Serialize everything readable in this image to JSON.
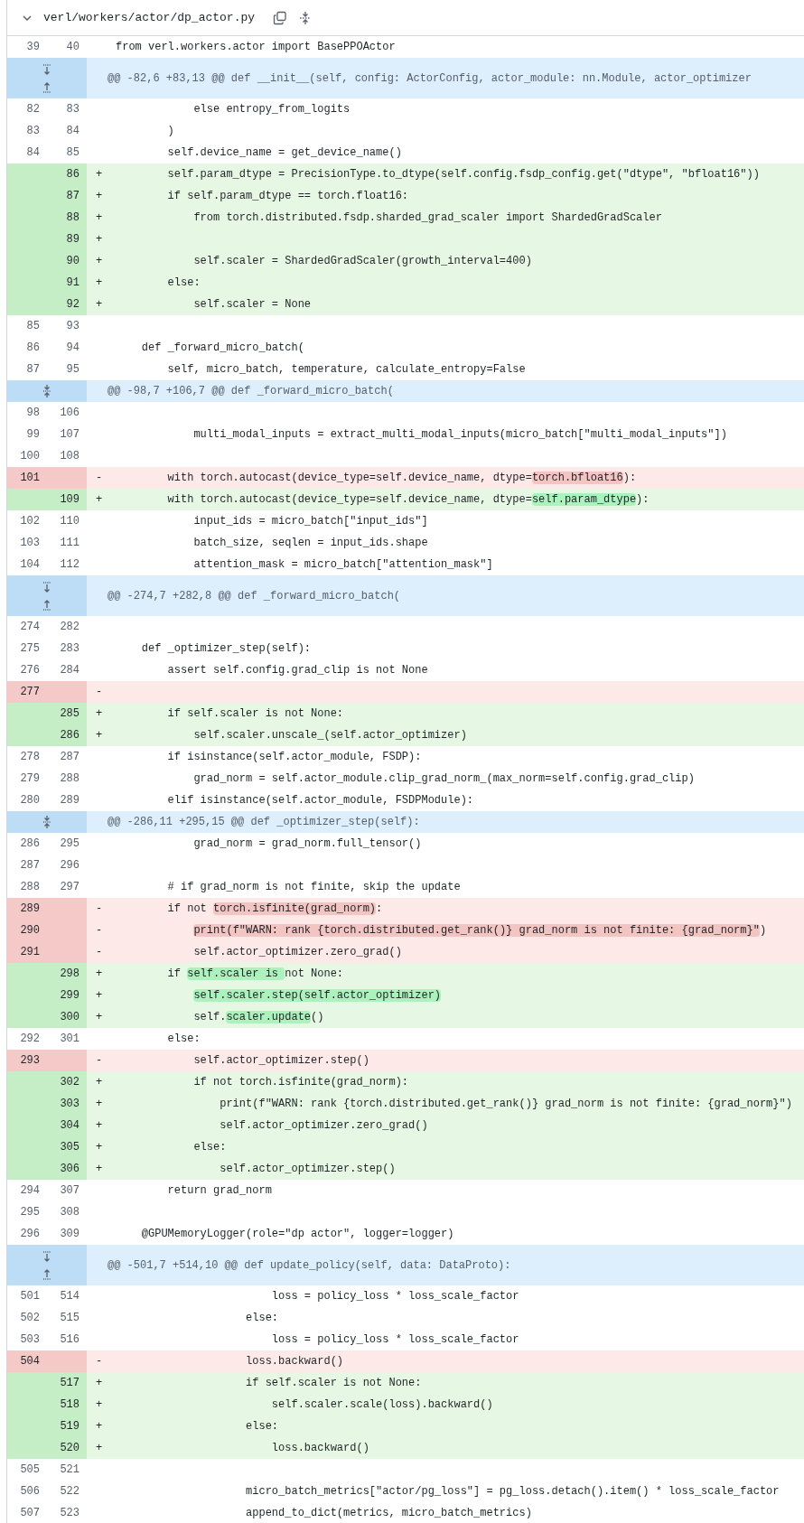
{
  "file_header": {
    "path": "verl/workers/actor/dp_actor.py"
  },
  "rows": [
    {
      "kind": "context",
      "old": "39",
      "new": "40",
      "code": [
        "from verl.workers.actor import BasePPOActor"
      ]
    },
    {
      "kind": "hunk",
      "split_expander": true,
      "code": [
        "@@ -82,6 +83,13 @@ def __init__(self, config: ActorConfig, actor_module: nn.Module, actor_optimizer"
      ]
    },
    {
      "kind": "context",
      "old": "82",
      "new": "83",
      "code": [
        "            else entropy_from_logits"
      ]
    },
    {
      "kind": "context",
      "old": "83",
      "new": "84",
      "code": [
        "        )"
      ]
    },
    {
      "kind": "context",
      "old": "84",
      "new": "85",
      "code": [
        "        self.device_name = get_device_name()"
      ]
    },
    {
      "kind": "add",
      "new": "86",
      "sign": "+",
      "code": [
        "        self.param_dtype = PrecisionType.to_dtype(self.config.fsdp_config.get(\"dtype\", \"bfloat16\"))"
      ]
    },
    {
      "kind": "add",
      "new": "87",
      "sign": "+",
      "code": [
        "        if self.param_dtype == torch.float16:"
      ]
    },
    {
      "kind": "add",
      "new": "88",
      "sign": "+",
      "code": [
        "            from torch.distributed.fsdp.sharded_grad_scaler import ShardedGradScaler"
      ]
    },
    {
      "kind": "add",
      "new": "89",
      "sign": "+"
    },
    {
      "kind": "add",
      "new": "90",
      "sign": "+",
      "code": [
        "            self.scaler = ShardedGradScaler(growth_interval=400)"
      ]
    },
    {
      "kind": "add",
      "new": "91",
      "sign": "+",
      "code": [
        "        else:"
      ]
    },
    {
      "kind": "add",
      "new": "92",
      "sign": "+",
      "code": [
        "            self.scaler = None"
      ]
    },
    {
      "kind": "context",
      "old": "85",
      "new": "93"
    },
    {
      "kind": "context",
      "old": "86",
      "new": "94",
      "code": [
        "    def _forward_micro_batch("
      ]
    },
    {
      "kind": "context",
      "old": "87",
      "new": "95",
      "code": [
        "        self, micro_batch, temperature, calculate_entropy=False"
      ]
    },
    {
      "kind": "hunk",
      "split_expander": false,
      "code": [
        "@@ -98,7 +106,7 @@ def _forward_micro_batch("
      ]
    },
    {
      "kind": "context",
      "old": "98",
      "new": "106"
    },
    {
      "kind": "context",
      "old": "99",
      "new": "107",
      "code": [
        "            multi_modal_inputs = extract_multi_modal_inputs(micro_batch[\"multi_modal_inputs\"])"
      ]
    },
    {
      "kind": "context",
      "old": "100",
      "new": "108"
    },
    {
      "kind": "del",
      "old": "101",
      "sign": "-",
      "code": [
        "        with torch.autocast(device_type=self.device_name, dtype=",
        "torch.bfloat16",
        "):"
      ],
      "changed": [
        false,
        true,
        false
      ]
    },
    {
      "kind": "add",
      "new": "109",
      "sign": "+",
      "code": [
        "        with torch.autocast(device_type=self.device_name, dtype=",
        "self.param_dtype",
        "):"
      ],
      "changed": [
        false,
        true,
        false
      ]
    },
    {
      "kind": "context",
      "old": "102",
      "new": "110",
      "code": [
        "            input_ids = micro_batch[\"input_ids\"]"
      ]
    },
    {
      "kind": "context",
      "old": "103",
      "new": "111",
      "code": [
        "            batch_size, seqlen = input_ids.shape"
      ]
    },
    {
      "kind": "context",
      "old": "104",
      "new": "112",
      "code": [
        "            attention_mask = micro_batch[\"attention_mask\"]"
      ]
    },
    {
      "kind": "hunk",
      "split_expander": true,
      "code": [
        "@@ -274,7 +282,8 @@ def _forward_micro_batch("
      ]
    },
    {
      "kind": "context",
      "old": "274",
      "new": "282"
    },
    {
      "kind": "context",
      "old": "275",
      "new": "283",
      "code": [
        "    def _optimizer_step(self):"
      ]
    },
    {
      "kind": "context",
      "old": "276",
      "new": "284",
      "code": [
        "        assert self.config.grad_clip is not None"
      ]
    },
    {
      "kind": "del",
      "old": "277",
      "sign": "-"
    },
    {
      "kind": "add",
      "new": "285",
      "sign": "+",
      "code": [
        "        if self.scaler is not None:"
      ]
    },
    {
      "kind": "add",
      "new": "286",
      "sign": "+",
      "code": [
        "            self.scaler.unscale_(self.actor_optimizer)"
      ]
    },
    {
      "kind": "context",
      "old": "278",
      "new": "287",
      "code": [
        "        if isinstance(self.actor_module, FSDP):"
      ]
    },
    {
      "kind": "context",
      "old": "279",
      "new": "288",
      "code": [
        "            grad_norm = self.actor_module.clip_grad_norm_(max_norm=self.config.grad_clip)"
      ]
    },
    {
      "kind": "context",
      "old": "280",
      "new": "289",
      "code": [
        "        elif isinstance(self.actor_module, FSDPModule):"
      ]
    },
    {
      "kind": "hunk",
      "split_expander": false,
      "code": [
        "@@ -286,11 +295,15 @@ def _optimizer_step(self):"
      ]
    },
    {
      "kind": "context",
      "old": "286",
      "new": "295",
      "code": [
        "            grad_norm = grad_norm.full_tensor()"
      ]
    },
    {
      "kind": "context",
      "old": "287",
      "new": "296"
    },
    {
      "kind": "context",
      "old": "288",
      "new": "297",
      "code": [
        "        # if grad_norm is not finite, skip the update"
      ]
    },
    {
      "kind": "del",
      "old": "289",
      "sign": "-",
      "code": [
        "        if not ",
        "torch.isfinite(grad_norm)",
        ":"
      ],
      "changed": [
        false,
        true,
        false
      ]
    },
    {
      "kind": "del",
      "old": "290",
      "sign": "-",
      "code": [
        "            print(f\"WARN: rank {torch.distributed.get_rank()} grad_norm is not finite: {grad_norm}\"",
        ")"
      ],
      "changed": [
        true,
        false
      ]
    },
    {
      "kind": "del",
      "old": "291",
      "sign": "-",
      "code": [
        "            self.actor_optimizer.zero_grad()"
      ]
    },
    {
      "kind": "add",
      "new": "298",
      "sign": "+",
      "code": [
        "        if ",
        "self.scaler is ",
        "not None:"
      ],
      "changed": [
        false,
        true,
        false
      ]
    },
    {
      "kind": "add",
      "new": "299",
      "sign": "+",
      "code": [
        "            self.scaler.step(self.actor_optimizer)"
      ],
      "changed": [
        true
      ]
    },
    {
      "kind": "add",
      "new": "300",
      "sign": "+",
      "code": [
        "            self.",
        "scaler.update",
        "()"
      ],
      "changed": [
        false,
        true,
        false
      ]
    },
    {
      "kind": "context",
      "old": "292",
      "new": "301",
      "code": [
        "        else:"
      ]
    },
    {
      "kind": "del",
      "old": "293",
      "sign": "-",
      "code": [
        "            self.actor_optimizer.step()"
      ]
    },
    {
      "kind": "add",
      "new": "302",
      "sign": "+",
      "code": [
        "            if not torch.isfinite(grad_norm):"
      ]
    },
    {
      "kind": "add",
      "new": "303",
      "sign": "+",
      "code": [
        "                print(f\"WARN: rank {torch.distributed.get_rank()} grad_norm is not finite: {grad_norm}\")"
      ]
    },
    {
      "kind": "add",
      "new": "304",
      "sign": "+",
      "code": [
        "                self.actor_optimizer.zero_grad()"
      ]
    },
    {
      "kind": "add",
      "new": "305",
      "sign": "+",
      "code": [
        "            else:"
      ]
    },
    {
      "kind": "add",
      "new": "306",
      "sign": "+",
      "code": [
        "                self.actor_optimizer.step()"
      ]
    },
    {
      "kind": "context",
      "old": "294",
      "new": "307",
      "code": [
        "        return grad_norm"
      ]
    },
    {
      "kind": "context",
      "old": "295",
      "new": "308"
    },
    {
      "kind": "context",
      "old": "296",
      "new": "309",
      "code": [
        "    @GPUMemoryLogger(role=\"dp actor\", logger=logger)"
      ]
    },
    {
      "kind": "hunk",
      "split_expander": true,
      "code": [
        "@@ -501,7 +514,10 @@ def update_policy(self, data: DataProto):"
      ]
    },
    {
      "kind": "context",
      "old": "501",
      "new": "514",
      "code": [
        "                        loss = policy_loss * loss_scale_factor"
      ]
    },
    {
      "kind": "context",
      "old": "502",
      "new": "515",
      "code": [
        "                    else:"
      ]
    },
    {
      "kind": "context",
      "old": "503",
      "new": "516",
      "code": [
        "                        loss = policy_loss * loss_scale_factor"
      ]
    },
    {
      "kind": "del",
      "old": "504",
      "sign": "-",
      "code": [
        "                    loss.backward()"
      ]
    },
    {
      "kind": "add",
      "new": "517",
      "sign": "+",
      "code": [
        "                    if self.scaler is not None:"
      ]
    },
    {
      "kind": "add",
      "new": "518",
      "sign": "+",
      "code": [
        "                        self.scaler.scale(loss).backward()"
      ]
    },
    {
      "kind": "add",
      "new": "519",
      "sign": "+",
      "code": [
        "                    else:"
      ]
    },
    {
      "kind": "add",
      "new": "520",
      "sign": "+",
      "code": [
        "                        loss.backward()"
      ]
    },
    {
      "kind": "context",
      "old": "505",
      "new": "521"
    },
    {
      "kind": "context",
      "old": "506",
      "new": "522",
      "code": [
        "                    micro_batch_metrics[\"actor/pg_loss\"] = pg_loss.detach().item() * loss_scale_factor"
      ]
    },
    {
      "kind": "context",
      "old": "507",
      "new": "523",
      "code": [
        "                    append_to_dict(metrics, micro_batch_metrics)"
      ]
    }
  ]
}
